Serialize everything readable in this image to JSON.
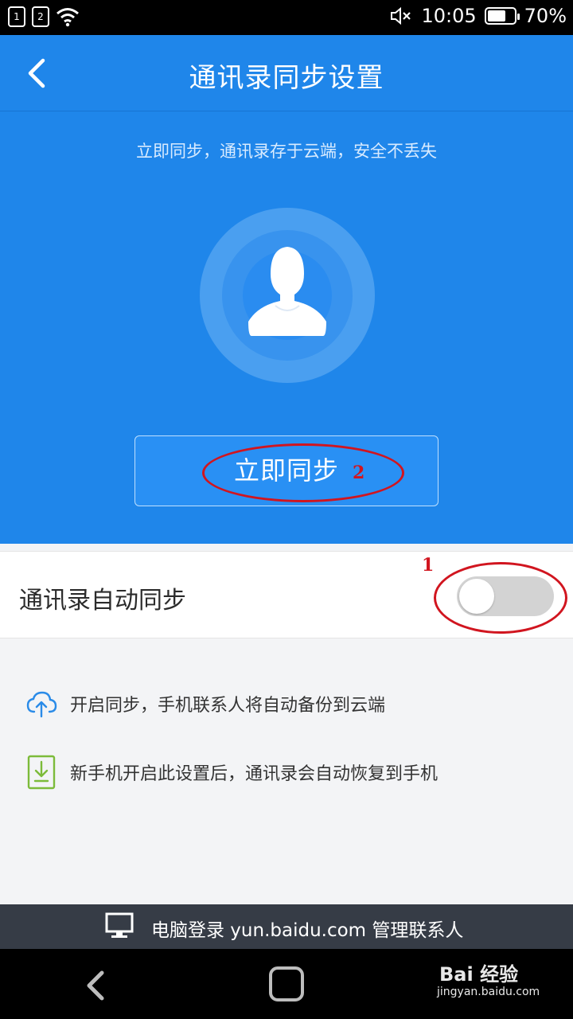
{
  "status_bar": {
    "sim1": "1",
    "sim2": "2",
    "time": "10:05",
    "battery": "70%",
    "battery_level": 0.7
  },
  "header": {
    "title": "通讯录同步设置"
  },
  "hero": {
    "subtitle": "立即同步，通讯录存于云端，安全不丢失",
    "sync_button": "立即同步",
    "annotation": "2"
  },
  "auto_sync": {
    "label": "通讯录自动同步",
    "enabled": false,
    "annotation": "1"
  },
  "info": [
    {
      "icon": "cloud-upload-icon",
      "text": "开启同步，手机联系人将自动备份到云端"
    },
    {
      "icon": "phone-download-icon",
      "text": "新手机开启此设置后，通讯录会自动恢复到手机"
    }
  ],
  "footer": {
    "text": "电脑登录 yun.baidu.com 管理联系人"
  },
  "watermark": {
    "brand": "Bai 经验",
    "url": "jingyan.baidu.com"
  },
  "colors": {
    "primary": "#1f86ea",
    "annotation": "#d1151f",
    "footer": "#363c46"
  }
}
